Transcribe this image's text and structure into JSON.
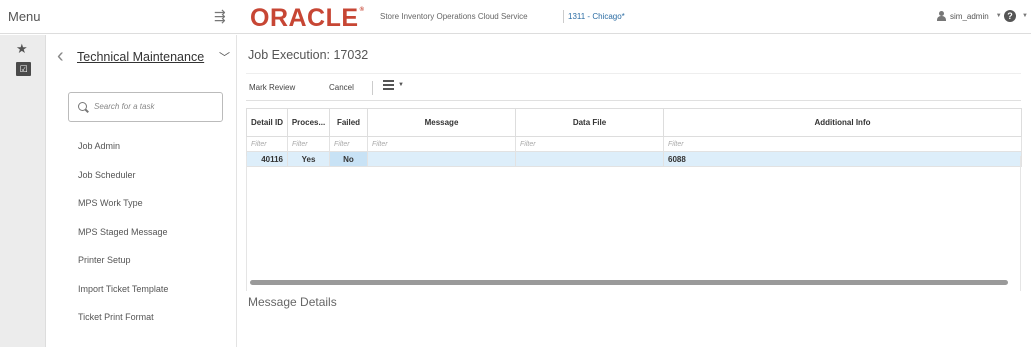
{
  "header": {
    "menu_label": "Menu",
    "logo": "ORACLE",
    "logo_mark": "®",
    "app_title": "Store Inventory Operations Cloud Service",
    "store": "1311 - Chicago*",
    "user": "sim_admin",
    "help_glyph": "?"
  },
  "sidebar": {
    "title": "Technical Maintenance",
    "search_placeholder": "Search for a task",
    "items": [
      {
        "label": "Job Admin"
      },
      {
        "label": "Job Scheduler"
      },
      {
        "label": "MPS Work Type"
      },
      {
        "label": "MPS Staged Message"
      },
      {
        "label": "Printer Setup"
      },
      {
        "label": "Import Ticket Template"
      },
      {
        "label": "Ticket Print Format"
      }
    ]
  },
  "main": {
    "title": "Job Execution: 17032",
    "toolbar": {
      "mark_review": "Mark Review",
      "cancel": "Cancel"
    },
    "table": {
      "columns": [
        "Detail ID",
        "Proces...",
        "Failed",
        "Message",
        "Data File",
        "Additional Info"
      ],
      "filter_placeholder": "Filter",
      "rows": [
        {
          "detail_id": "40116",
          "processed": "Yes",
          "failed": "No",
          "message": "",
          "data_file": "",
          "additional_info": "6088"
        }
      ]
    },
    "details_title": "Message Details"
  },
  "icons": {
    "menu_toggle": "list-collapse-icon",
    "favorites": "star-icon",
    "tasks": "task-checkbox-icon",
    "user": "user-icon",
    "help": "help-icon",
    "search": "search-icon",
    "view": "view-menu-icon"
  },
  "colors": {
    "brand": "#c74634",
    "store_link": "#2b6ca3",
    "selected_row": "#ddeefa"
  }
}
